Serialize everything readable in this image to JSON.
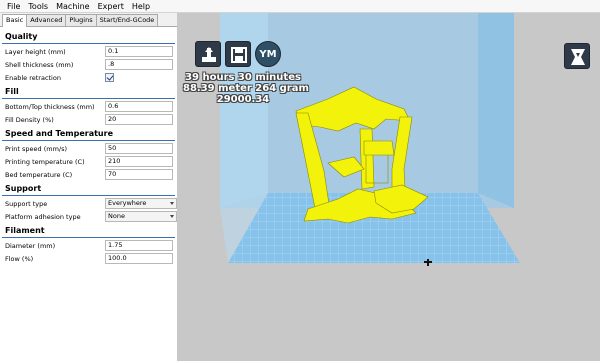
{
  "menu": [
    "File",
    "Tools",
    "Machine",
    "Expert",
    "Help"
  ],
  "tabs": [
    "Basic",
    "Advanced",
    "Plugins",
    "Start/End-GCode"
  ],
  "sections": {
    "quality": {
      "title": "Quality",
      "layer_height": {
        "label": "Layer height (mm)",
        "value": "0.1"
      },
      "shell_thickness": {
        "label": "Shell thickness (mm)",
        "value": ".8"
      },
      "retraction": {
        "label": "Enable retraction",
        "checked": true
      }
    },
    "fill": {
      "title": "Fill",
      "bottom_top": {
        "label": "Bottom/Top thickness (mm)",
        "value": "0.6"
      },
      "density": {
        "label": "Fill Density (%)",
        "value": "20"
      }
    },
    "speed": {
      "title": "Speed and Temperature",
      "print_speed": {
        "label": "Print speed (mm/s)",
        "value": "50"
      },
      "print_temp": {
        "label": "Printing temperature (C)",
        "value": "210"
      },
      "bed_temp": {
        "label": "Bed temperature (C)",
        "value": "70"
      }
    },
    "support": {
      "title": "Support",
      "type": {
        "label": "Support type",
        "value": "Everywhere"
      },
      "adhesion": {
        "label": "Platform adhesion type",
        "value": "None"
      }
    },
    "filament": {
      "title": "Filament",
      "diameter": {
        "label": "Diameter (mm)",
        "value": "1.75"
      },
      "flow": {
        "label": "Flow (%)",
        "value": "100.0"
      }
    }
  },
  "viewport": {
    "print_time": "39 hours 30 minutes",
    "material": "88.39 meter 264 gram",
    "cost": "29000.34",
    "ym_label": "YM",
    "icons": [
      "load-model-icon",
      "save-gcode-icon",
      "ym-icon",
      "view-mode-icon"
    ],
    "colors": {
      "model": "#f2f20a",
      "build_volume": "#8fc4e8",
      "platform": "#7fbde6",
      "background": "#c8c8c8"
    }
  }
}
